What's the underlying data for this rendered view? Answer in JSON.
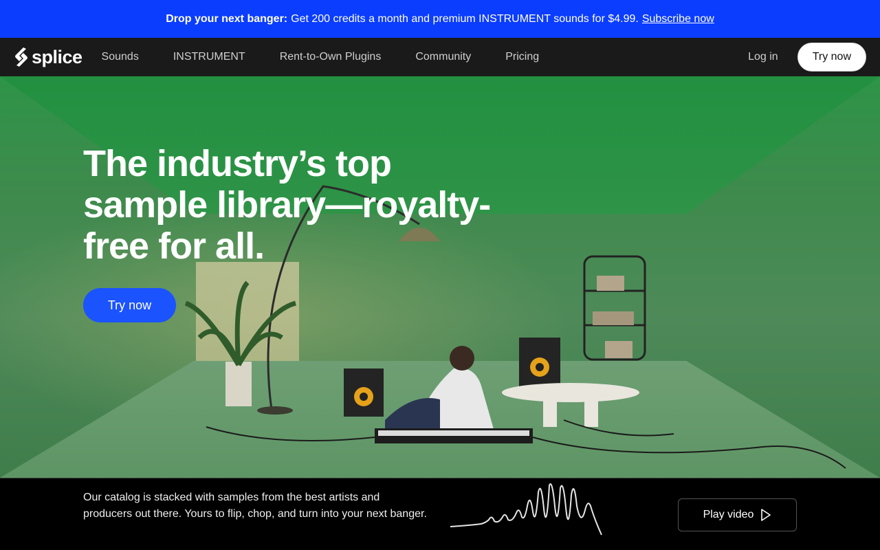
{
  "promo": {
    "bold": "Drop your next banger:",
    "text": "Get 200 credits a month and premium INSTRUMENT sounds for $4.99.",
    "link": "Subscribe now"
  },
  "nav": {
    "logo": "splice",
    "links": [
      "Sounds",
      "INSTRUMENT",
      "Rent-to-Own Plugins",
      "Community",
      "Pricing"
    ],
    "login": "Log in",
    "try": "Try now"
  },
  "hero": {
    "headline": "The industry’s top sample library—royalty-free for all.",
    "cta": "Try now"
  },
  "bottom": {
    "text": "Our catalog is stacked with samples from the best artists and producers out there. Yours to flip, chop, and turn into your next banger.",
    "play": "Play video"
  },
  "colors": {
    "promo_bg": "#0b3dff",
    "cta_blue": "#1b53ff",
    "nav_bg": "#1a1a1a"
  }
}
